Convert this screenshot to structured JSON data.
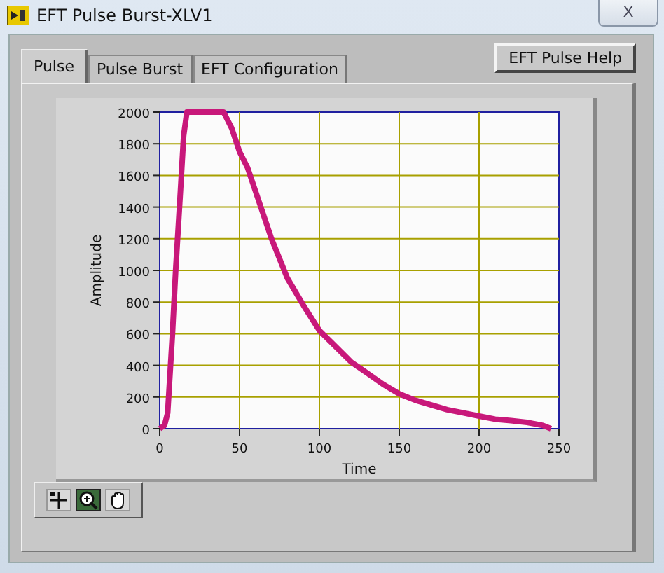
{
  "window": {
    "title": "EFT Pulse Burst-XLV1",
    "close": "X"
  },
  "tabs": [
    {
      "label": "Pulse",
      "selected": true
    },
    {
      "label": "Pulse Burst",
      "selected": false
    },
    {
      "label": "EFT Configuration",
      "selected": false
    }
  ],
  "help_button": "EFT Pulse Help",
  "graph": {
    "chart_data": {
      "type": "line",
      "xlabel": "Time",
      "ylabel": "Amplitude",
      "xlim": [
        0,
        250
      ],
      "ylim": [
        0,
        2000
      ],
      "xticks": [
        0,
        50,
        100,
        150,
        200,
        250
      ],
      "yticks": [
        0,
        200,
        400,
        600,
        800,
        1000,
        1200,
        1400,
        1600,
        1800,
        2000
      ],
      "x": [
        0,
        3,
        5,
        8,
        10,
        13,
        15,
        17,
        20,
        25,
        30,
        35,
        40,
        45,
        50,
        55,
        60,
        70,
        80,
        90,
        100,
        110,
        120,
        130,
        140,
        150,
        160,
        170,
        180,
        190,
        200,
        210,
        220,
        230,
        240,
        245
      ],
      "grid": true,
      "series": [
        {
          "color": "#c8187a",
          "values": [
            0,
            20,
            100,
            600,
            1000,
            1500,
            1850,
            2000,
            2000,
            2000,
            2000,
            2000,
            2000,
            1900,
            1750,
            1650,
            1500,
            1200,
            950,
            780,
            620,
            520,
            420,
            350,
            280,
            220,
            180,
            150,
            120,
            100,
            80,
            60,
            50,
            40,
            20,
            0
          ]
        }
      ]
    }
  },
  "tools": [
    {
      "kind": "cursor",
      "selected": false
    },
    {
      "kind": "zoom",
      "selected": true
    },
    {
      "kind": "pan",
      "selected": false
    }
  ]
}
